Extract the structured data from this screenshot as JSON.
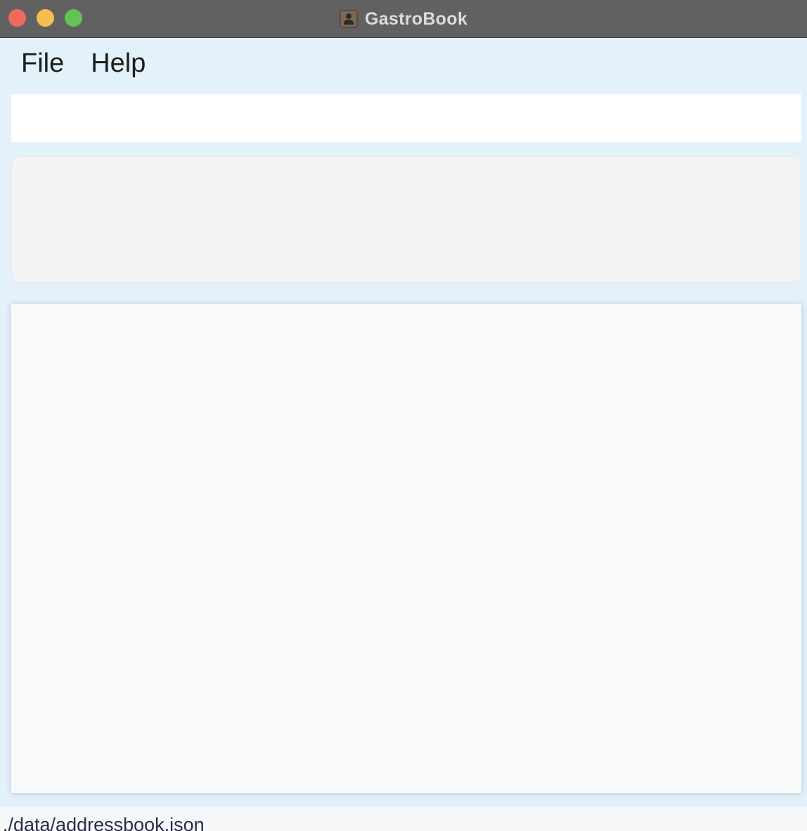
{
  "window": {
    "title": "GastroBook",
    "app_icon": "contact-book-icon"
  },
  "menubar": {
    "items": [
      {
        "label": "File"
      },
      {
        "label": "Help"
      }
    ]
  },
  "command_box": {
    "value": "",
    "placeholder": ""
  },
  "result_display": {
    "text": ""
  },
  "status_bar": {
    "save_location": "./data/addressbook.json"
  },
  "colors": {
    "background": "#e3f1fb",
    "titlebar": "#616161",
    "close": "#ee6a5f",
    "minimize": "#f5be4f",
    "maximize": "#61c454"
  }
}
